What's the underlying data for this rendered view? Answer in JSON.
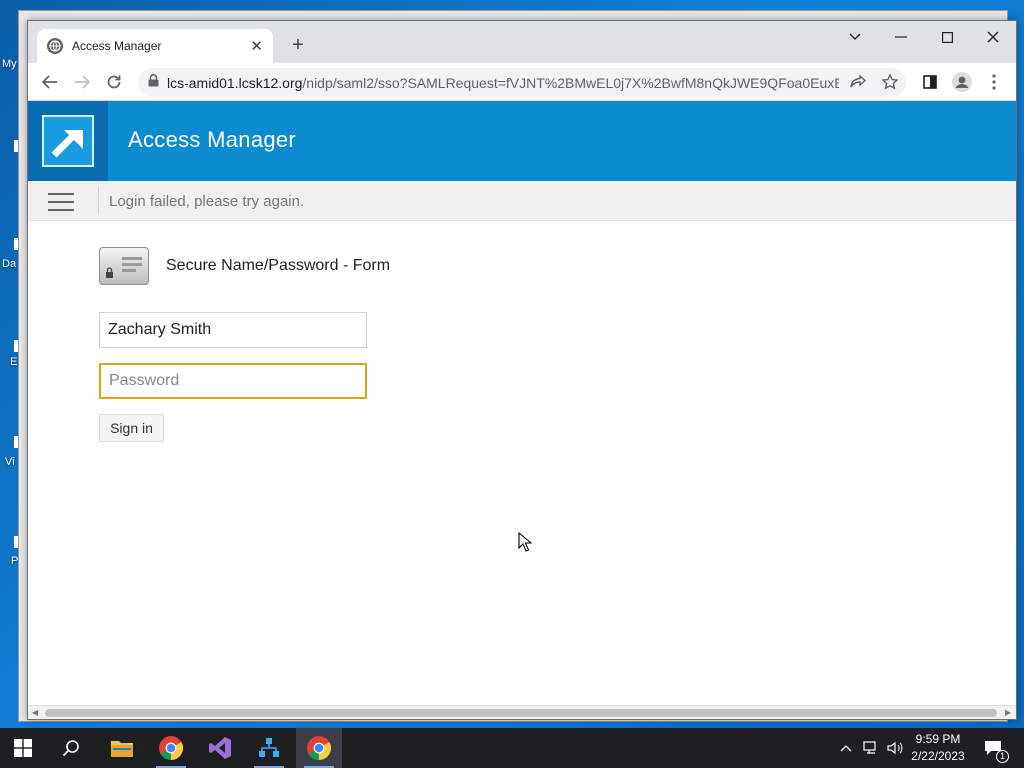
{
  "desktop": {
    "icon_labels": [
      "My",
      "Da",
      "E",
      "Vi",
      "P"
    ]
  },
  "browser": {
    "tab_title": "Access Manager",
    "url_host": "lcs-amid01.lcsk12.org",
    "url_path": "/nidp/saml2/sso?SAMLRequest=fVJNT%2BMwEL0j7X%2BwfM8nQkJWE9QFoa0EuxEN..."
  },
  "page": {
    "brand_title": "Access Manager",
    "status_message": "Login failed, please try again.",
    "form_title": "Secure Name/Password - Form",
    "username_value": "Zachary Smith",
    "password_placeholder": "Password",
    "signin_label": "Sign in"
  },
  "taskbar": {
    "time": "9:59 PM",
    "date": "2/22/2023",
    "notification_count": "1"
  },
  "colors": {
    "banner": "#0d8bd1",
    "logo_bg": "#0a6cb0",
    "focus_border": "#e0a21b"
  }
}
